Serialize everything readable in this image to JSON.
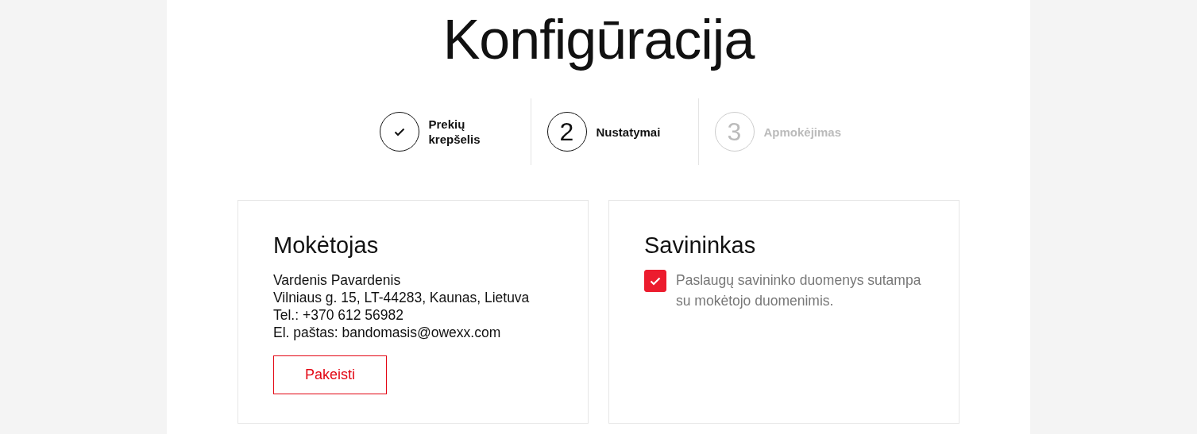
{
  "title": "Konfigūracija",
  "steps": [
    {
      "kind": "done",
      "label": "Prekių krepšelis"
    },
    {
      "kind": "current",
      "number": "2",
      "label": "Nustatymai"
    },
    {
      "kind": "upcoming",
      "number": "3",
      "label": "Apmokėjimas"
    }
  ],
  "payer": {
    "heading": "Mokėtojas",
    "lines": [
      "Vardenis Pavardenis",
      "Vilniaus g. 15, LT-44283, Kaunas, Lietuva",
      "Tel.: +370 612 56982",
      "El. paštas: bandomasis@owexx.com"
    ],
    "button": "Pakeisti"
  },
  "owner": {
    "heading": "Savininkas",
    "checkbox": {
      "checked": true,
      "label": "Paslaugų savininko duomenys sutampa su mokėtojo duomenimis."
    }
  }
}
